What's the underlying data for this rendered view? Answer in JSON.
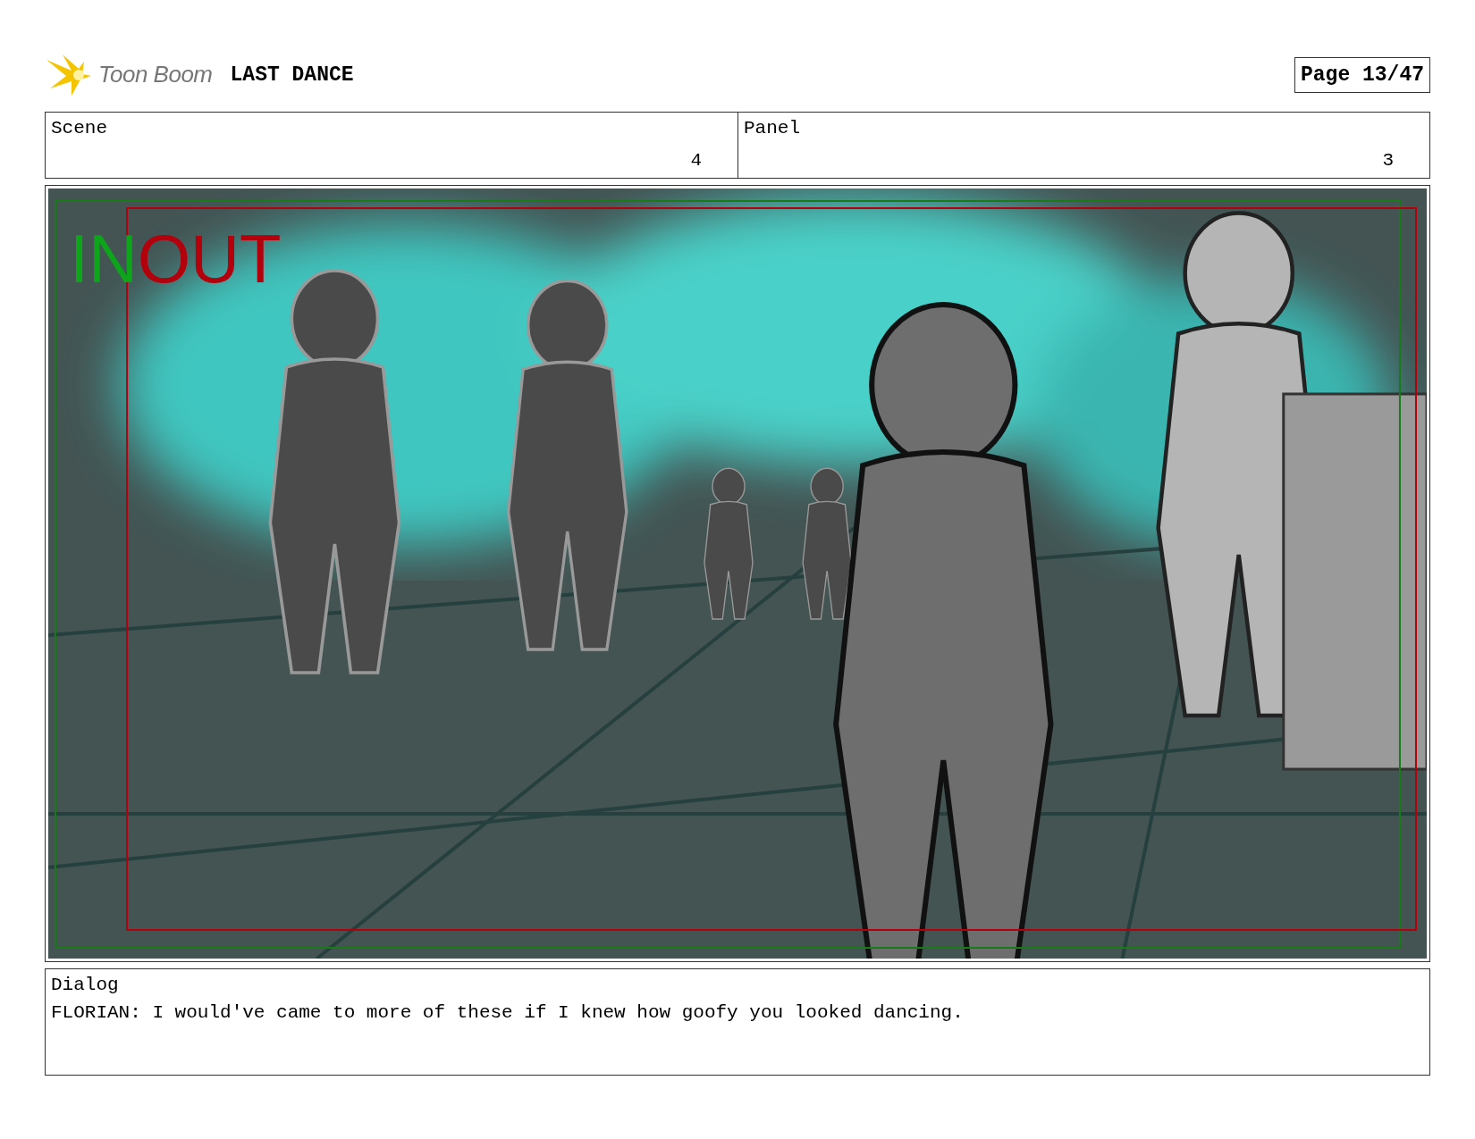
{
  "header": {
    "logo": "Toon Boom",
    "title": "LAST DANCE",
    "page": "Page 13/47"
  },
  "fields": [
    {
      "label": "Scene",
      "value": "4"
    },
    {
      "label": "Panel",
      "value": "3"
    }
  ],
  "panel": {
    "in_label": "IN",
    "out_label": "OUT"
  },
  "dialog": {
    "label": "Dialog",
    "text": "FLORIAN: I would've came to more of these if I knew how goofy you looked dancing."
  }
}
